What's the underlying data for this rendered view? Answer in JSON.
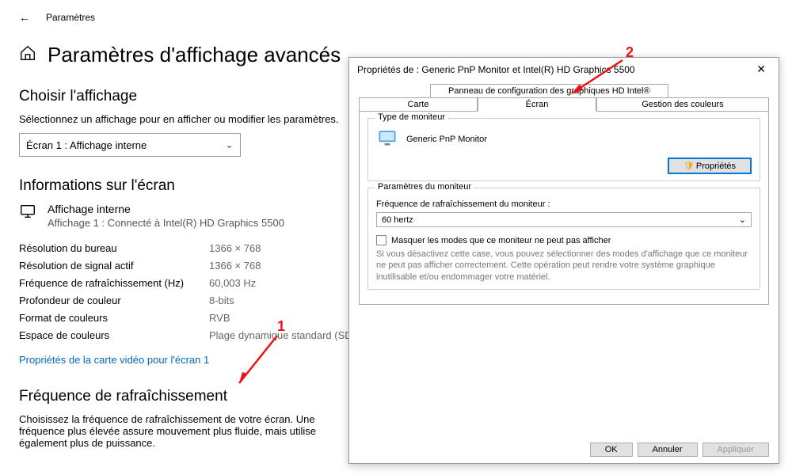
{
  "topbar": {
    "back": "←",
    "breadcrumb": "Paramètres"
  },
  "page": {
    "title": "Paramètres d'affichage avancés"
  },
  "choose": {
    "heading": "Choisir l'affichage",
    "desc": "Sélectionnez un affichage pour en afficher ou modifier les paramètres.",
    "selected": "Écran 1 : Affichage interne"
  },
  "info": {
    "heading": "Informations sur l'écran",
    "display_name": "Affichage interne",
    "display_sub": "Affichage 1 : Connecté à Intel(R) HD Graphics 5500",
    "rows": [
      {
        "k": "Résolution du bureau",
        "v": "1366 × 768"
      },
      {
        "k": "Résolution de signal actif",
        "v": "1366 × 768"
      },
      {
        "k": "Fréquence de rafraîchissement (Hz)",
        "v": "60,003 Hz"
      },
      {
        "k": "Profondeur de couleur",
        "v": "8-bits"
      },
      {
        "k": "Format de couleurs",
        "v": "RVB"
      },
      {
        "k": "Espace de couleurs",
        "v": "Plage dynamique standard (SDR)"
      }
    ],
    "link": "Propriétés de la carte vidéo pour l'écran 1"
  },
  "refresh": {
    "heading": "Fréquence de rafraîchissement",
    "desc": "Choisissez la fréquence de rafraîchissement de votre écran. Une fréquence plus élevée assure mouvement plus fluide, mais utilise également plus de puissance."
  },
  "dialog": {
    "title": "Propriétés de : Generic PnP Monitor et Intel(R) HD Graphics 5500",
    "tabs": {
      "top": "Panneau de configuration des graphiques HD Intel®",
      "b1": "Carte",
      "b2": "Écran",
      "b3": "Gestion des couleurs"
    },
    "group1": {
      "title": "Type de moniteur",
      "name": "Generic PnP Monitor",
      "btn": "Propriétés"
    },
    "group2": {
      "title": "Paramètres du moniteur",
      "freq_label": "Fréquence de rafraîchissement du moniteur :",
      "freq_value": "60 hertz",
      "chk_label": "Masquer les modes que ce moniteur ne peut pas afficher",
      "hint": "Si vous désactivez cette case, vous pouvez sélectionner des modes d'affichage que ce moniteur ne peut pas afficher correctement. Cette opération peut rendre votre système graphique inutilisable et/ou endommager votre matériel."
    },
    "buttons": {
      "ok": "OK",
      "cancel": "Annuler",
      "apply": "Appliquer"
    }
  },
  "annotations": {
    "one": "1",
    "two": "2"
  }
}
